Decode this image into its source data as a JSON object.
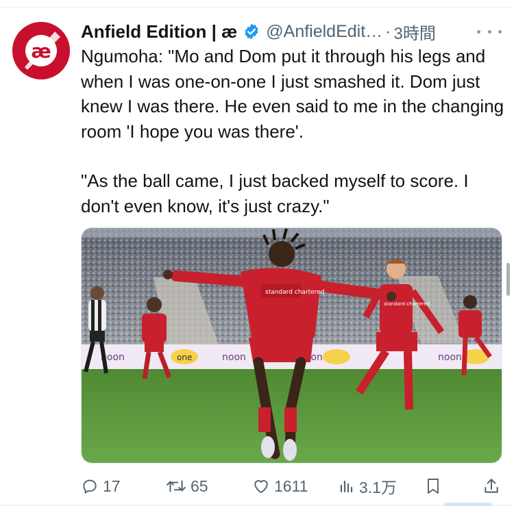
{
  "tweet": {
    "author_name": "Anfield Edition | æ",
    "handle": "@AnfieldEdit…",
    "separator": "·",
    "time": "3時間",
    "avatar_text": "æ",
    "body": [
      "Ngumoha: \"Mo and Dom put it through his legs and when I was one-on-one I just smashed it. Dom just knew I was there. He even said to me in the changing room 'I hope you was there'.",
      "\"As the ball came, I just backed myself to score. I don't even know, it's just crazy.\""
    ],
    "media": {
      "board_text_1": "noon",
      "board_text_2": "one",
      "sponsor_1": "standard chartered",
      "sponsor_2": "standard chartered"
    },
    "actions": {
      "replies": "17",
      "reposts": "65",
      "likes": "1611",
      "views": "3.1万"
    }
  },
  "colors": {
    "accent": "#1d9bf0",
    "brand_red": "#c8102e",
    "muted": "#536471"
  },
  "icons": [
    "verified-badge-icon",
    "more-icon",
    "reply-icon",
    "repost-icon",
    "like-icon",
    "views-icon",
    "bookmark-icon",
    "share-icon"
  ]
}
